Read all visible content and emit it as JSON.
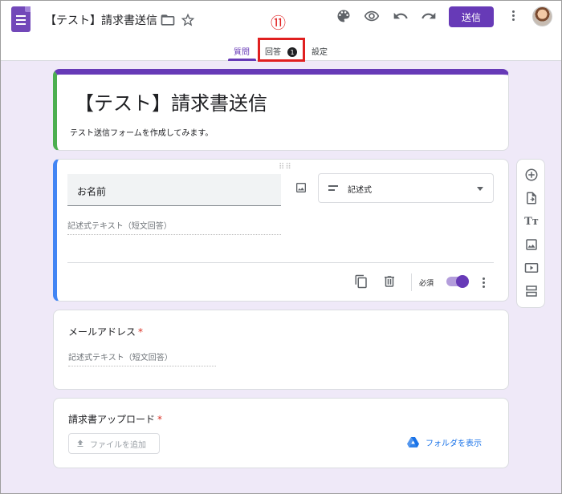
{
  "header": {
    "doc_title": "【テスト】請求書送信",
    "send_label": "送信",
    "icons": [
      "forms-app-icon",
      "folder-icon",
      "star-icon",
      "palette-icon",
      "eye-icon",
      "undo-icon",
      "redo-icon",
      "more-vert-icon"
    ]
  },
  "tabs": [
    {
      "label": "質問",
      "active": true
    },
    {
      "label": "回答",
      "badge": "1"
    },
    {
      "label": "設定"
    }
  ],
  "annotation": {
    "callout": "⑪"
  },
  "form": {
    "title": "【テスト】請求書送信",
    "description": "テスト送信フォームを作成してみます。"
  },
  "question_editing": {
    "title_value": "お名前",
    "type_label": "記述式",
    "answer_placeholder": "記述式テキスト（短文回答）",
    "required_label": "必須",
    "required": true
  },
  "question_email": {
    "title": "メールアドレス",
    "required_mark": "*",
    "answer_placeholder": "記述式テキスト（短文回答）"
  },
  "question_upload": {
    "title": "請求書アップロード",
    "required_mark": "*",
    "button_label": "ファイルを追加",
    "folder_link": "フォルダを表示"
  },
  "colors": {
    "accent": "#673ab7",
    "background": "#efe9f8",
    "annotation_red": "#e02020",
    "link": "#1a73e8"
  }
}
